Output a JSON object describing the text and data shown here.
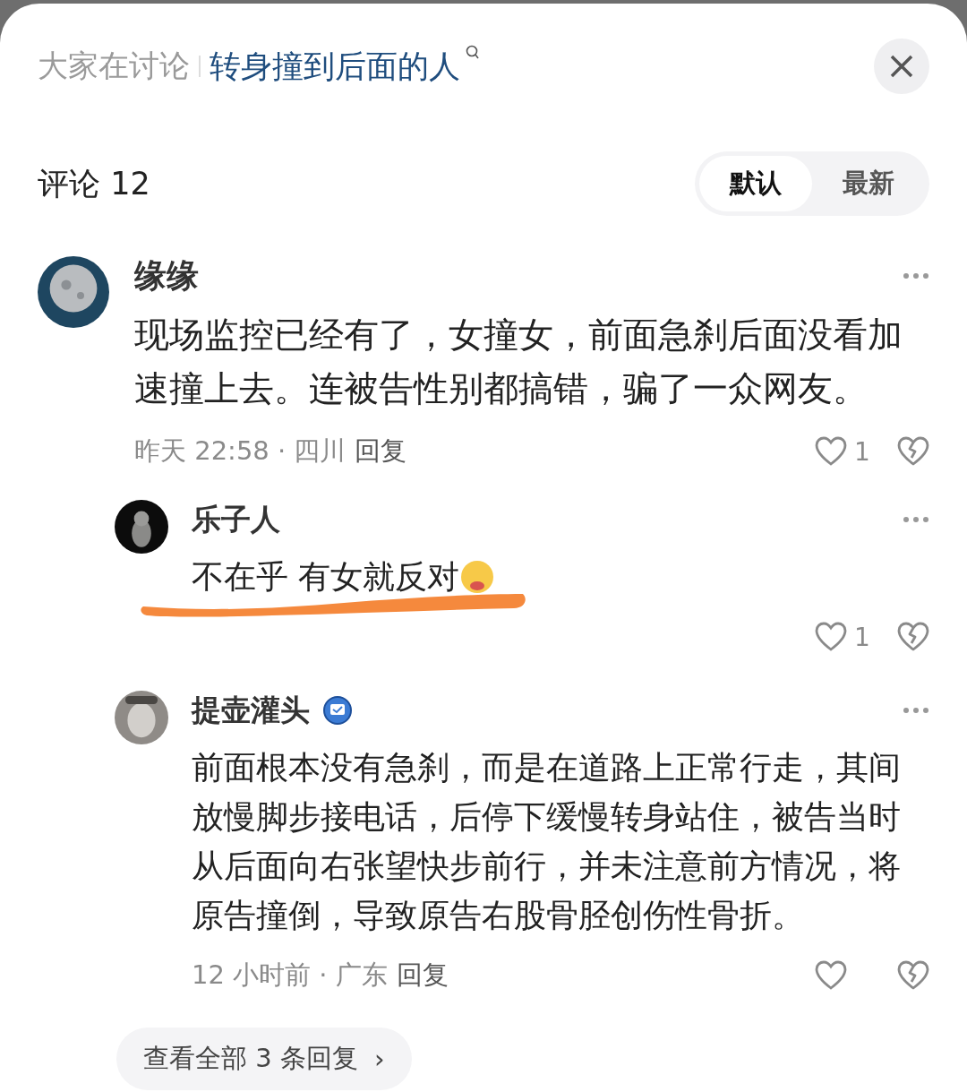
{
  "header": {
    "label": "大家在讨论",
    "topic": "转身撞到后面的人"
  },
  "comments_header": {
    "title": "评论 12",
    "sort_tabs": [
      {
        "label": "默认",
        "selected": true
      },
      {
        "label": "最新",
        "selected": false
      }
    ]
  },
  "comment": {
    "name": "缘缘",
    "verified": false,
    "text": "现场监控已经有了，女撞女，前面急刹后面没看加速撞上去。连被告性别都搞错，骗了一众网友。",
    "emoji": false,
    "scribbled": false,
    "time": "昨天 22:58",
    "separator": "·",
    "region": "四川",
    "reply": "回复",
    "like_count": "1",
    "replies": [
      {
        "name": "乐子人",
        "verified": false,
        "text": "不在乎 有女就反对",
        "emoji": true,
        "scribbled": true,
        "like_count": "1"
      },
      {
        "name": "提壶灌头",
        "verified": true,
        "text": "前面根本没有急刹，而是在道路上正常行走，其间放慢脚步接电话，后停下缓慢转身站住，被告当时从后面向右张望快步前行，并未注意前方情况，将原告撞倒，导致原告右股骨胫创伤性骨折。",
        "emoji": false,
        "scribbled": false,
        "time": "12 小时前",
        "separator": "·",
        "region": "广东",
        "reply": "回复"
      }
    ],
    "view_all": {
      "label": "查看全部 3 条回复",
      "chevron": "›"
    }
  }
}
